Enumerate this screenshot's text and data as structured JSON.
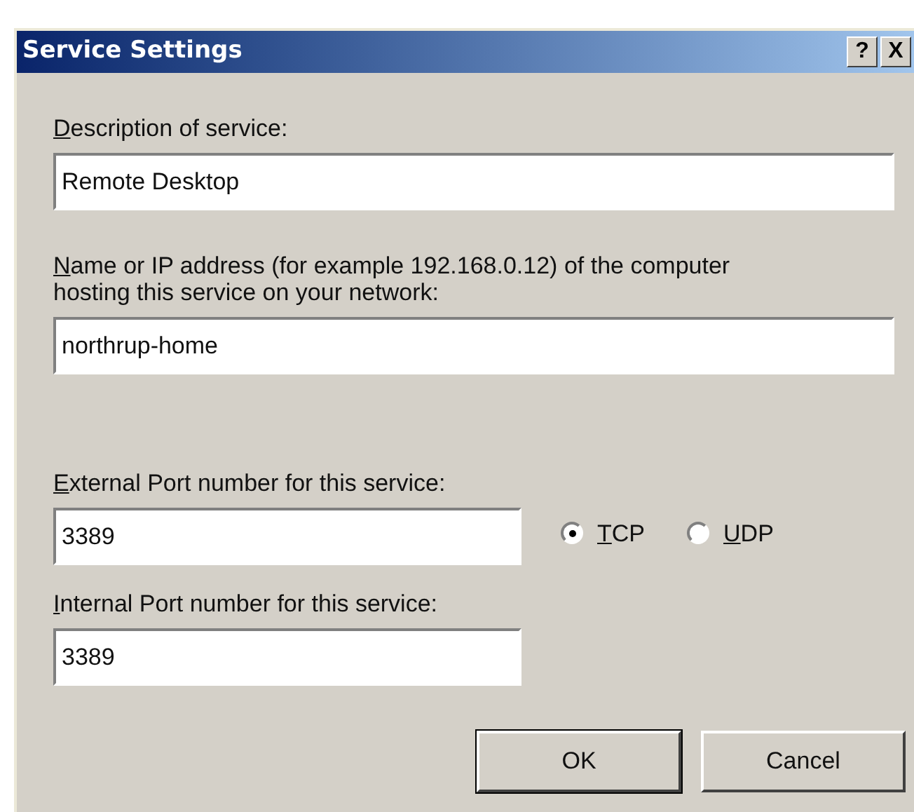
{
  "window": {
    "title": "Service Settings",
    "title_buttons": [
      "?",
      "X"
    ]
  },
  "fields": [
    {
      "label": "Description of service:",
      "mnemonic": true,
      "value": "Remote Desktop",
      "kind": "wide"
    },
    {
      "label": "Name or IP address (for example 192.168.0.12) of the computer hosting this service on your network:",
      "mnemonic": true,
      "value": "northrup-home",
      "kind": "wide"
    },
    {
      "label": "External Port number for this service:",
      "mnemonic": true,
      "value": "3389",
      "kind": "port"
    },
    {
      "label": "Internal Port number for this service:",
      "mnemonic": true,
      "value": "3389",
      "kind": "port"
    }
  ],
  "protocol": [
    {
      "label": "TCP",
      "mnemonic": true,
      "selected": true
    },
    {
      "label": "UDP",
      "mnemonic": true,
      "selected": false
    }
  ],
  "buttons": [
    {
      "label": "OK",
      "default": true
    },
    {
      "label": "Cancel",
      "default": false
    }
  ]
}
